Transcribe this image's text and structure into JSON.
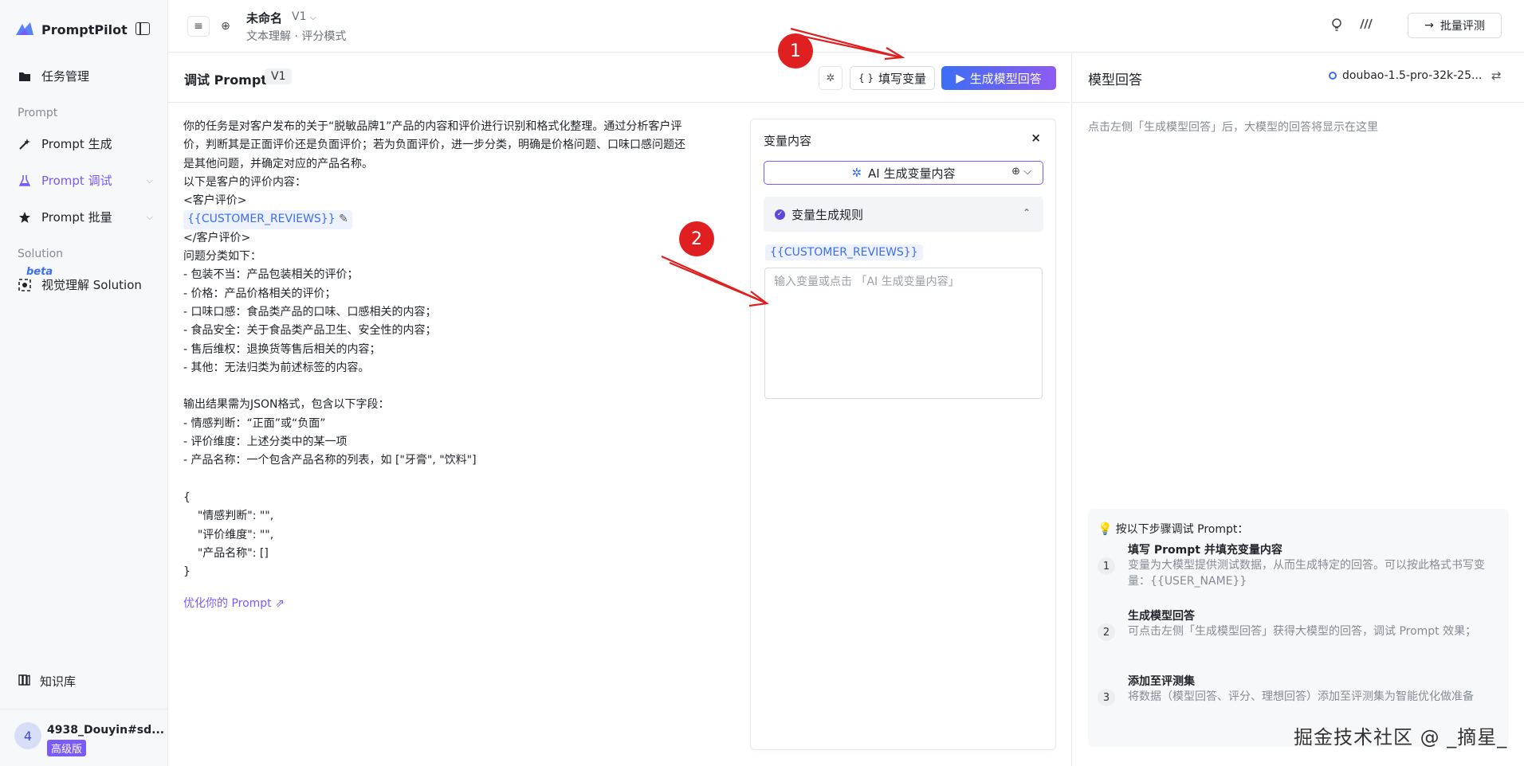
{
  "brand": {
    "name": "PromptPilot"
  },
  "sidebar": {
    "task_mgmt": "任务管理",
    "section_prompt": "Prompt",
    "prompt_gen": "Prompt 生成",
    "prompt_debug": "Prompt 调试",
    "prompt_batch": "Prompt 批量",
    "section_solution": "Solution",
    "beta": "beta",
    "visual_solution": "视觉理解 Solution",
    "knowledge": "知识库",
    "user_initial": "4",
    "user_name": "4938_Douyin#sd...",
    "user_badge": "高级版"
  },
  "topbar": {
    "title": "未命名",
    "version": "V1",
    "subtitle": "文本理解 · 评分模式",
    "batch_label": "批量评测"
  },
  "editor": {
    "title": "调试 Prompt",
    "version": "V1",
    "fill_label": "填写变量",
    "fill_icon": "{ }",
    "gen_label": "生成模型回答",
    "lines_before": "你的任务是对客户发布的关于“脱敏品牌1”产品的内容和评价进行识别和格式化整理。通过分析客户评\n价，判断其是正面评价还是负面评价；若为负面评价，进一步分类，明确是价格问题、口味口感问题还\n是其他问题，并确定对应的产品名称。\n以下是客户的评价内容：\n<客户评价>",
    "variable": "{{CUSTOMER_REVIEWS}}",
    "lines_after": "</客户评价>\n问题分类如下：\n- 包装不当：产品包装相关的评价；\n- 价格：产品价格相关的评价；\n- 口味口感：食品类产品的口味、口感相关的内容；\n- 食品安全：关于食品类产品卫生、安全性的内容；\n- 售后维权：退换货等售后相关的内容；\n- 其他：无法归类为前述标签的内容。\n\n输出结果需为JSON格式，包含以下字段：\n- 情感判断：“正面”或“负面”\n- 评价维度：上述分类中的某一项\n- 产品名称：一个包含产品名称的列表，如 [\"牙膏\", \"饮料\"]\n\n{\n    \"情感判断\": \"\",\n    \"评价维度\": \"\",\n    \"产品名称\": []\n}",
    "optimize_link": "优化你的 Prompt"
  },
  "var_panel": {
    "title": "变量内容",
    "ai_gen_label": "AI 生成变量内容",
    "rule_label": "变量生成规则",
    "var_name": "{{CUSTOMER_REVIEWS}}",
    "placeholder": "输入变量或点击 「AI 生成变量内容」"
  },
  "right": {
    "title": "模型回答",
    "model": "doubao-1.5-pro-32k-25...",
    "hint": "点击左侧「生成模型回答」后，大模型的回答将显示在这里",
    "steps_title": "按以下步骤调试 Prompt：",
    "steps": [
      {
        "num": "1",
        "title": "填写 Prompt 并填充变量内容",
        "desc": "变量为大模型提供测试数据，从而生成特定的回答。可以按此格式书写变量：{{USER_NAME}}"
      },
      {
        "num": "2",
        "title": "生成模型回答",
        "desc": "可点击左侧「生成模型回答」获得大模型的回答，调试 Prompt 效果；"
      },
      {
        "num": "3",
        "title": "添加至评测集",
        "desc": "将数据（模型回答、评分、理想回答）添加至评测集为智能优化做准备"
      }
    ]
  },
  "annotations": {
    "one": "1",
    "two": "2",
    "color": "#e02020"
  },
  "watermark": "掘金技术社区 @ _摘星_",
  "colors": {
    "accent": "#7a5af8",
    "link": "#3b6ef5"
  }
}
